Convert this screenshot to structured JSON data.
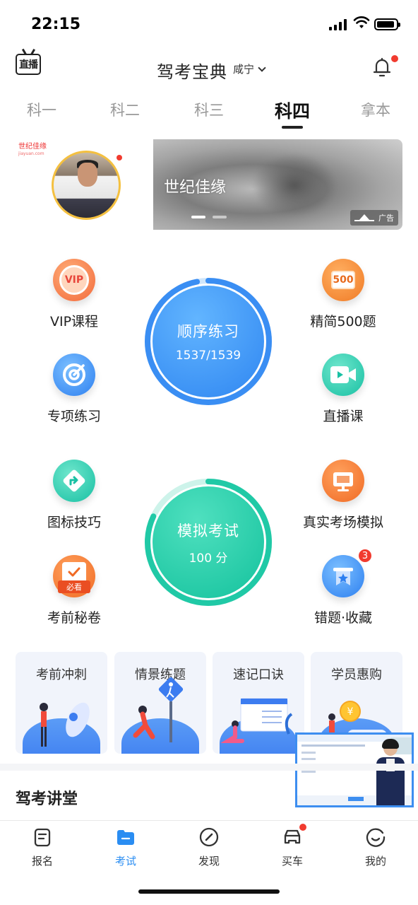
{
  "status_bar": {
    "time": "22:15"
  },
  "header": {
    "live_label": "直播",
    "title": "驾考宝典",
    "city": "咸宁"
  },
  "subject_tabs": [
    "科一",
    "科二",
    "科三",
    "科四",
    "拿本"
  ],
  "active_tab": "科四",
  "banner": {
    "brand_mini": "世纪佳缘",
    "brand_mini_sub": "jiayuan.com",
    "ad_text": "世纪佳缘",
    "ad_label": "广告"
  },
  "features": {
    "vip": {
      "label": "VIP课程",
      "icon_text": "VIP"
    },
    "jingjian": {
      "label": "精简500题",
      "icon_text": "500"
    },
    "zhuanxiang": {
      "label": "专项练习"
    },
    "zhibo": {
      "label": "直播课"
    },
    "tubiao": {
      "label": "图标技巧"
    },
    "zhenshi": {
      "label": "真实考场模拟"
    },
    "miquan": {
      "label": "考前秘卷",
      "icon_text": "必看"
    },
    "cuoti": {
      "label": "错题·收藏",
      "badge": "3"
    }
  },
  "sequence_practice": {
    "title": "顺序练习",
    "progress_text": "1537/1539",
    "done": 1537,
    "total": 1539
  },
  "mock_exam": {
    "title": "模拟考试",
    "score_text": "100 分",
    "fill": 0.82
  },
  "cards": [
    {
      "title": "考前冲刺"
    },
    {
      "title": "情景练题"
    },
    {
      "title": "速记口诀"
    },
    {
      "title": "学员惠购"
    }
  ],
  "section": {
    "title": "驾考讲堂"
  },
  "tabbar": [
    {
      "label": "报名",
      "icon": "clipboard-icon"
    },
    {
      "label": "考试",
      "icon": "folder-icon"
    },
    {
      "label": "发现",
      "icon": "compass-icon"
    },
    {
      "label": "买车",
      "icon": "car-icon"
    },
    {
      "label": "我的",
      "icon": "smile-icon"
    }
  ],
  "colors": {
    "accent_blue": "#2a8df2",
    "accent_teal": "#1ccaa8",
    "notify_red": "#f13b2f"
  }
}
